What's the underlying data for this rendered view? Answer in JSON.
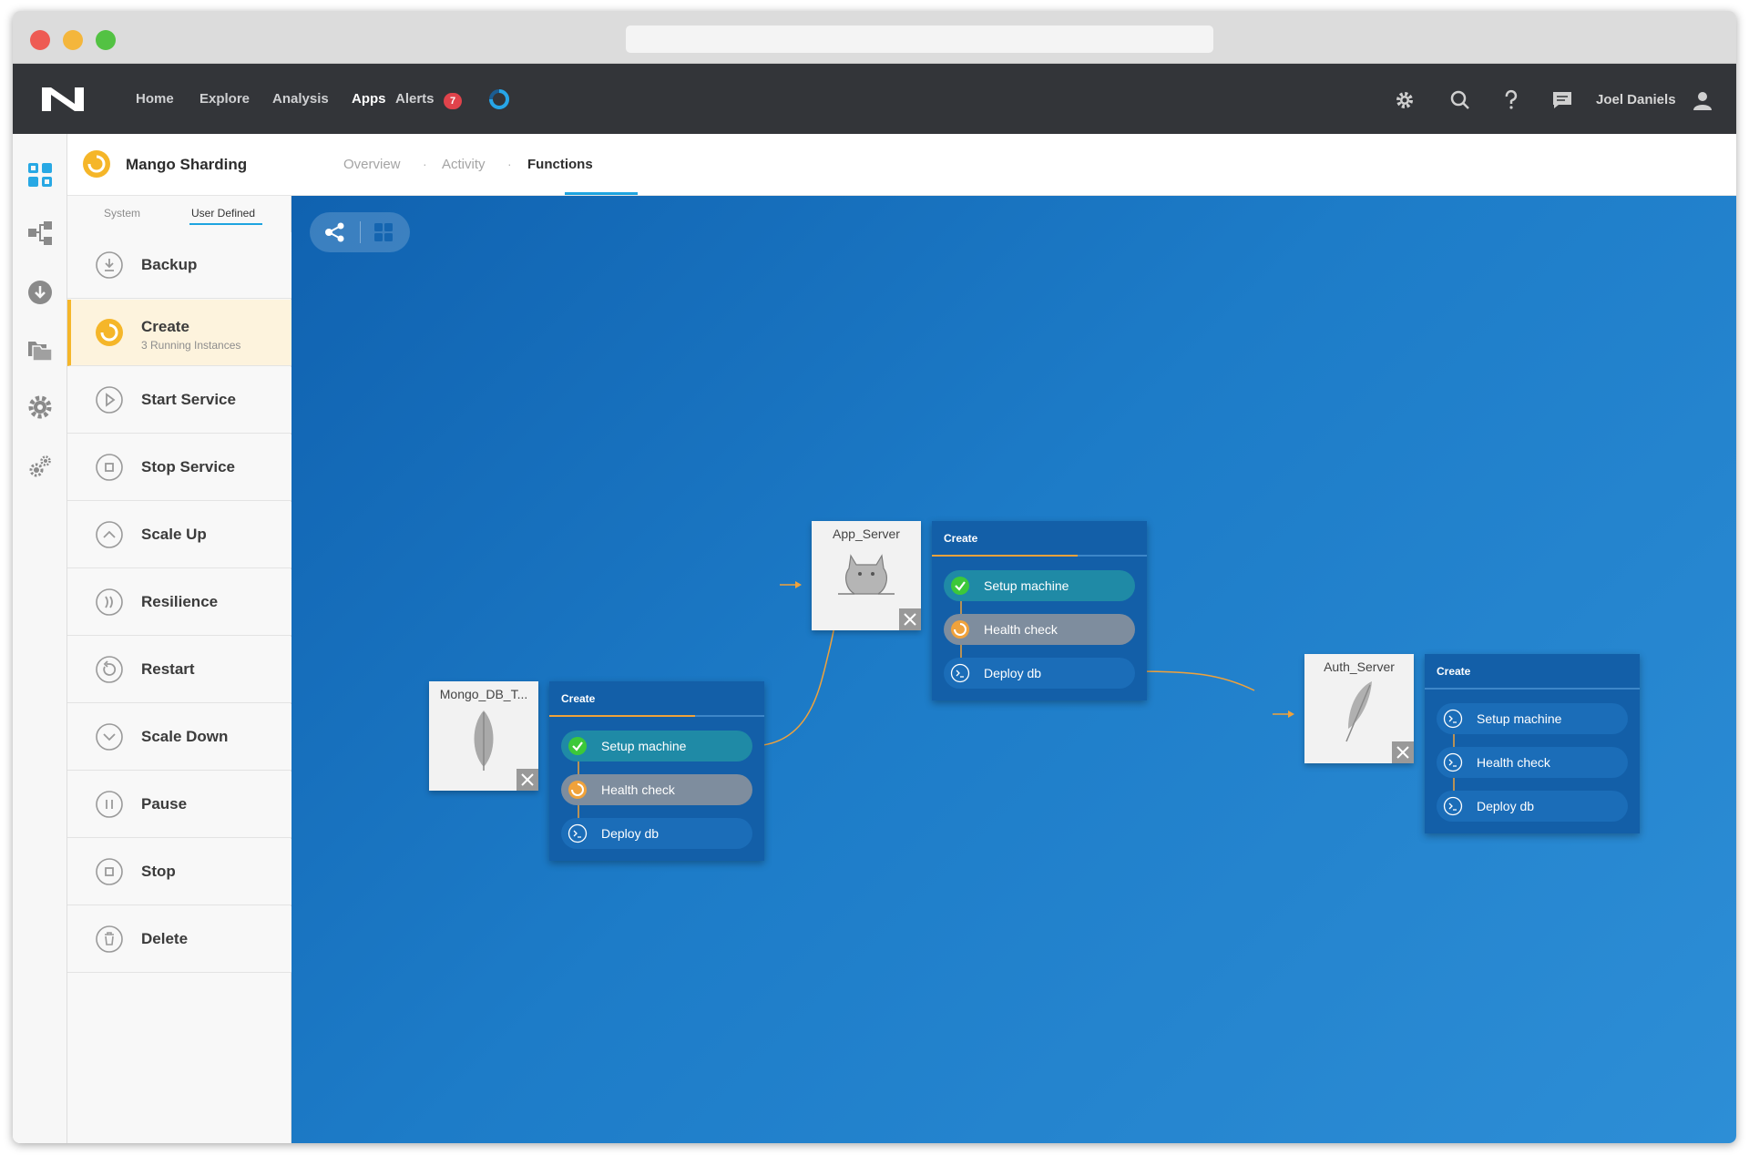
{
  "nav": {
    "items": [
      "Home",
      "Explore",
      "Analysis",
      "Apps",
      "Alerts"
    ],
    "alerts_count": "7",
    "user_name": "Joel Daniels"
  },
  "app": {
    "title": "Mango Sharding",
    "tabs": [
      "Overview",
      "Activity",
      "Functions"
    ],
    "active_tab": "Functions"
  },
  "sidebar": {
    "tabs": [
      "System",
      "User Defined"
    ],
    "active_tab": "User Defined",
    "functions": [
      {
        "label": "Backup",
        "icon": "download-icon"
      },
      {
        "label": "Create",
        "sub": "3 Running Instances",
        "icon": "spinner-icon"
      },
      {
        "label": "Start Service",
        "icon": "play-icon"
      },
      {
        "label": "Stop Service",
        "icon": "stop-icon"
      },
      {
        "label": "Scale Up",
        "icon": "chevron-up-icon"
      },
      {
        "label": "Resilience",
        "icon": "resilience-icon"
      },
      {
        "label": "Restart",
        "icon": "restart-icon"
      },
      {
        "label": "Scale Down",
        "icon": "chevron-down-icon"
      },
      {
        "label": "Pause",
        "icon": "pause-icon"
      },
      {
        "label": "Stop",
        "icon": "stop-icon"
      },
      {
        "label": "Delete",
        "icon": "trash-icon"
      }
    ]
  },
  "canvas": {
    "nodes": [
      {
        "name": "Mongo_DB_T...",
        "icon": "mongodb-leaf-icon"
      },
      {
        "name": "App_Server",
        "icon": "tomcat-icon"
      },
      {
        "name": "Auth_Server",
        "icon": "feather-icon"
      }
    ],
    "workflows": [
      {
        "title": "Create",
        "steps": [
          "Setup machine",
          "Health check",
          "Deploy db"
        ]
      },
      {
        "title": "Create",
        "steps": [
          "Setup machine",
          "Health check",
          "Deploy db"
        ]
      },
      {
        "title": "Create",
        "steps": [
          "Setup machine",
          "Health check",
          "Deploy db"
        ]
      }
    ]
  },
  "colors": {
    "accent": "#1ea4e0",
    "running": "#f5b629",
    "success": "#3cc83a",
    "warning": "#f0a23b",
    "nav_bg": "#333539",
    "canvas_bg": "#1d7cc8"
  }
}
